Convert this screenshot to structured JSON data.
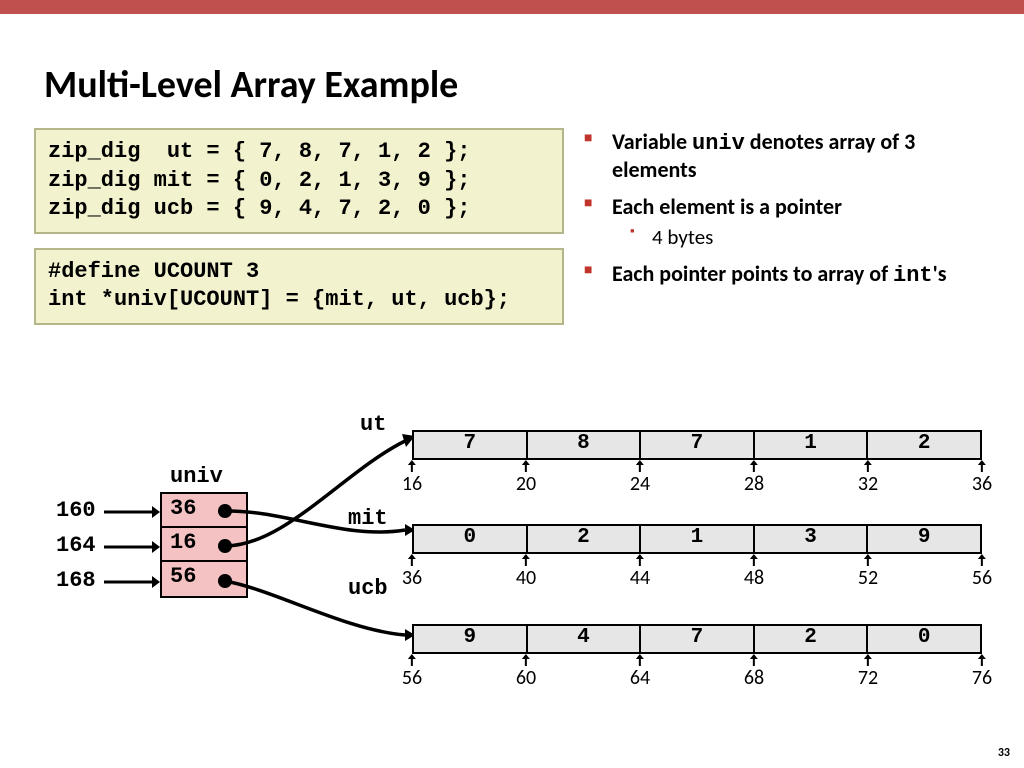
{
  "title": "Multi-Level Array Example",
  "code1": "zip_dig  ut = { 7, 8, 7, 1, 2 };\nzip_dig mit = { 0, 2, 1, 3, 9 };\nzip_dig ucb = { 9, 4, 7, 2, 0 };",
  "code2": "#define UCOUNT 3\nint *univ[UCOUNT] = {mit, ut, ucb};",
  "bullets": {
    "b1a": "Variable ",
    "b1m": "univ",
    "b1b": " denotes array of 3 elements",
    "b2": "Each element is a pointer",
    "b2s1": "4 bytes",
    "b3a": "Each pointer points to array of ",
    "b3m": "int",
    "b3b": "'s"
  },
  "labels": {
    "ut": "ut",
    "mit": "mit",
    "ucb": "ucb",
    "univ": "univ"
  },
  "addrs": {
    "a0": "160",
    "a1": "164",
    "a2": "168"
  },
  "univ": {
    "c0": "36",
    "c1": "16",
    "c2": "56"
  },
  "rows": {
    "ut": {
      "v": [
        "7",
        "8",
        "7",
        "1",
        "2"
      ],
      "t": [
        "16",
        "20",
        "24",
        "28",
        "32",
        "36"
      ]
    },
    "mit": {
      "v": [
        "0",
        "2",
        "1",
        "3",
        "9"
      ],
      "t": [
        "36",
        "40",
        "44",
        "48",
        "52",
        "56"
      ]
    },
    "ucb": {
      "v": [
        "9",
        "4",
        "7",
        "2",
        "0"
      ],
      "t": [
        "56",
        "60",
        "64",
        "68",
        "72",
        "76"
      ]
    }
  },
  "page": "33"
}
